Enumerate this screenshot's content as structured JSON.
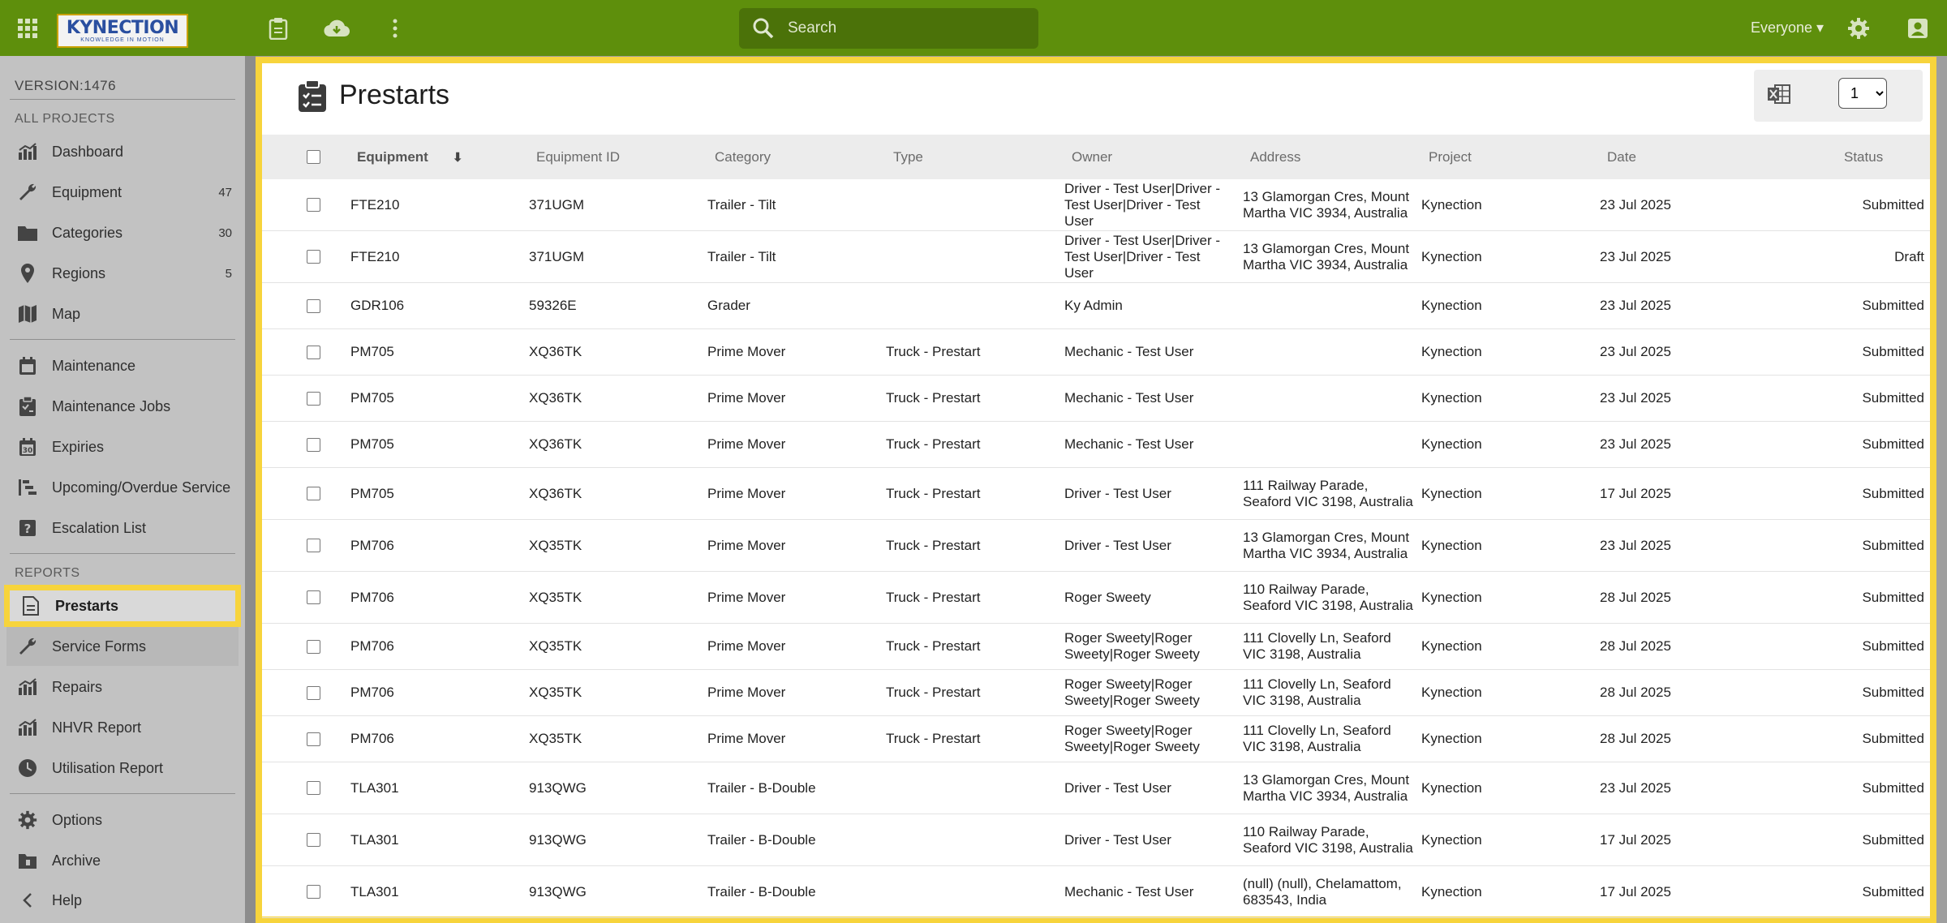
{
  "header": {
    "logo_text": "KYNECTION",
    "logo_tagline": "KNOWLEDGE IN MOTION",
    "search_placeholder": "Search",
    "user_scope": "Everyone ▾"
  },
  "sidebar": {
    "version": "VERSION:1476",
    "all_projects_label": "ALL PROJECTS",
    "reports_label": "REPORTS",
    "items_top": [
      {
        "label": "Dashboard",
        "count": "",
        "icon": "chart-icon"
      },
      {
        "label": "Equipment",
        "count": "47",
        "icon": "wrench-icon"
      },
      {
        "label": "Categories",
        "count": "30",
        "icon": "folder-icon"
      },
      {
        "label": "Regions",
        "count": "5",
        "icon": "pin-icon"
      },
      {
        "label": "Map",
        "count": "",
        "icon": "map-icon"
      }
    ],
    "items_mid": [
      {
        "label": "Maintenance",
        "icon": "calendar-icon"
      },
      {
        "label": "Maintenance Jobs",
        "icon": "clipboard-icon"
      },
      {
        "label": "Expiries",
        "icon": "calendar-30-icon"
      },
      {
        "label": "Upcoming/Overdue Service",
        "icon": "timeline-icon"
      },
      {
        "label": "Escalation List",
        "icon": "question-icon"
      }
    ],
    "items_reports": [
      {
        "label": "Prestarts",
        "icon": "document-icon"
      },
      {
        "label": "Service Forms",
        "icon": "wrench-icon"
      },
      {
        "label": "Repairs",
        "icon": "chart-icon"
      },
      {
        "label": "NHVR Report",
        "icon": "chart-icon"
      },
      {
        "label": "Utilisation Report",
        "icon": "clock-icon"
      }
    ],
    "items_bottom": [
      {
        "label": "Options",
        "icon": "gear-icon"
      },
      {
        "label": "Archive",
        "icon": "archive-icon"
      },
      {
        "label": "Help",
        "icon": "chevron-left-icon"
      }
    ]
  },
  "page": {
    "title": "Prestarts",
    "page_select_value": "1"
  },
  "table": {
    "columns": [
      "Equipment",
      "Equipment ID",
      "Category",
      "Type",
      "Owner",
      "Address",
      "Project",
      "Date",
      "Status"
    ],
    "rows": [
      {
        "equipment": "FTE210",
        "equipment_id": "371UGM",
        "category": "Trailer - Tilt",
        "type": "",
        "owner": "Driver - Test User|Driver - Test User|Driver - Test User",
        "address": "13 Glamorgan Cres, Mount Martha VIC 3934, Australia",
        "project": "Kynection",
        "date": "23 Jul 2025",
        "status": "Submitted"
      },
      {
        "equipment": "FTE210",
        "equipment_id": "371UGM",
        "category": "Trailer - Tilt",
        "type": "",
        "owner": "Driver - Test User|Driver - Test User|Driver - Test User",
        "address": "13 Glamorgan Cres, Mount Martha VIC 3934, Australia",
        "project": "Kynection",
        "date": "23 Jul 2025",
        "status": "Draft"
      },
      {
        "equipment": "GDR106",
        "equipment_id": "59326E",
        "category": "Grader",
        "type": "",
        "owner": "Ky Admin",
        "address": "",
        "project": "Kynection",
        "date": "23 Jul 2025",
        "status": "Submitted"
      },
      {
        "equipment": "PM705",
        "equipment_id": "XQ36TK",
        "category": "Prime Mover",
        "type": "Truck - Prestart",
        "owner": "Mechanic - Test User",
        "address": "",
        "project": "Kynection",
        "date": "23 Jul 2025",
        "status": "Submitted"
      },
      {
        "equipment": "PM705",
        "equipment_id": "XQ36TK",
        "category": "Prime Mover",
        "type": "Truck - Prestart",
        "owner": "Mechanic - Test User",
        "address": "",
        "project": "Kynection",
        "date": "23 Jul 2025",
        "status": "Submitted"
      },
      {
        "equipment": "PM705",
        "equipment_id": "XQ36TK",
        "category": "Prime Mover",
        "type": "Truck - Prestart",
        "owner": "Mechanic - Test User",
        "address": "",
        "project": "Kynection",
        "date": "23 Jul 2025",
        "status": "Submitted"
      },
      {
        "equipment": "PM705",
        "equipment_id": "XQ36TK",
        "category": "Prime Mover",
        "type": "Truck - Prestart",
        "owner": "Driver - Test User",
        "address": "111 Railway Parade, Seaford VIC 3198, Australia",
        "project": "Kynection",
        "date": "17 Jul 2025",
        "status": "Submitted"
      },
      {
        "equipment": "PM706",
        "equipment_id": "XQ35TK",
        "category": "Prime Mover",
        "type": "Truck - Prestart",
        "owner": "Driver - Test User",
        "address": "13 Glamorgan Cres, Mount Martha VIC 3934, Australia",
        "project": "Kynection",
        "date": "23 Jul 2025",
        "status": "Submitted"
      },
      {
        "equipment": "PM706",
        "equipment_id": "XQ35TK",
        "category": "Prime Mover",
        "type": "Truck - Prestart",
        "owner": "Roger Sweety",
        "address": "110 Railway Parade, Seaford VIC 3198, Australia",
        "project": "Kynection",
        "date": "28 Jul 2025",
        "status": "Submitted"
      },
      {
        "equipment": "PM706",
        "equipment_id": "XQ35TK",
        "category": "Prime Mover",
        "type": "Truck - Prestart",
        "owner": "Roger Sweety|Roger Sweety|Roger Sweety",
        "address": "111 Clovelly Ln, Seaford VIC 3198, Australia",
        "project": "Kynection",
        "date": "28 Jul 2025",
        "status": "Submitted"
      },
      {
        "equipment": "PM706",
        "equipment_id": "XQ35TK",
        "category": "Prime Mover",
        "type": "Truck - Prestart",
        "owner": "Roger Sweety|Roger Sweety|Roger Sweety",
        "address": "111 Clovelly Ln, Seaford VIC 3198, Australia",
        "project": "Kynection",
        "date": "28 Jul 2025",
        "status": "Submitted"
      },
      {
        "equipment": "PM706",
        "equipment_id": "XQ35TK",
        "category": "Prime Mover",
        "type": "Truck - Prestart",
        "owner": "Roger Sweety|Roger Sweety|Roger Sweety",
        "address": "111 Clovelly Ln, Seaford VIC 3198, Australia",
        "project": "Kynection",
        "date": "28 Jul 2025",
        "status": "Submitted"
      },
      {
        "equipment": "TLA301",
        "equipment_id": "913QWG",
        "category": "Trailer - B-Double",
        "type": "",
        "owner": "Driver - Test User",
        "address": "13 Glamorgan Cres, Mount Martha VIC 3934, Australia",
        "project": "Kynection",
        "date": "23 Jul 2025",
        "status": "Submitted"
      },
      {
        "equipment": "TLA301",
        "equipment_id": "913QWG",
        "category": "Trailer - B-Double",
        "type": "",
        "owner": "Driver - Test User",
        "address": "110 Railway Parade, Seaford VIC 3198, Australia",
        "project": "Kynection",
        "date": "17 Jul 2025",
        "status": "Submitted"
      },
      {
        "equipment": "TLA301",
        "equipment_id": "913QWG",
        "category": "Trailer - B-Double",
        "type": "",
        "owner": "Mechanic - Test User",
        "address": "(null) (null), Chelamattom, 683543, India",
        "project": "Kynection",
        "date": "17 Jul 2025",
        "status": "Submitted"
      }
    ]
  },
  "colors": {
    "topbar": "#5e8f0c",
    "highlight": "#f7d43c",
    "sidebar": "#c2c2c2"
  }
}
